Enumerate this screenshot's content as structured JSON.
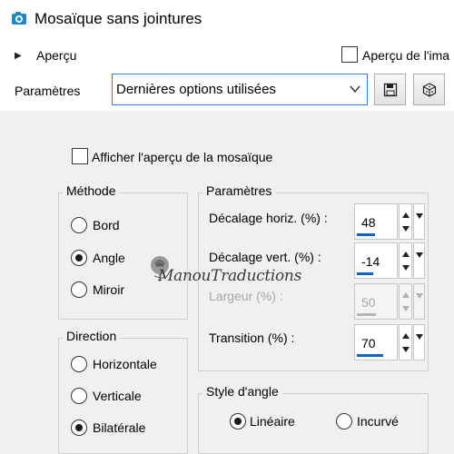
{
  "window": {
    "title": "Mosaïque sans jointures"
  },
  "preview": {
    "expander_label": "Aperçu",
    "image_preview_label": "Aperçu de l'ima"
  },
  "presets": {
    "label": "Paramètres",
    "selected": "Dernières options utilisées",
    "save_icon": "floppy-disk-icon",
    "random_icon": "dice-icon"
  },
  "show_tile_preview": {
    "label": "Afficher l'aperçu de la mosaïque",
    "checked": false
  },
  "method": {
    "title": "Méthode",
    "options": [
      {
        "label": "Bord",
        "selected": false
      },
      {
        "label": "Angle",
        "selected": true
      },
      {
        "label": "Miroir",
        "selected": false
      }
    ]
  },
  "direction": {
    "title": "Direction",
    "options": [
      {
        "label": "Horizontale",
        "selected": false
      },
      {
        "label": "Verticale",
        "selected": false
      },
      {
        "label": "Bilatérale",
        "selected": true
      }
    ]
  },
  "parameters": {
    "title": "Paramètres",
    "fields": [
      {
        "label": "Décalage horiz. (%) :",
        "value": "48",
        "enabled": true,
        "level": 0.48
      },
      {
        "label": "Décalage vert. (%) :",
        "value": "-14",
        "enabled": true,
        "level": 0.43
      },
      {
        "label": "Largeur (%) :",
        "value": "50",
        "enabled": false,
        "level": 0.5
      },
      {
        "label": "Transition (%) :",
        "value": "70",
        "enabled": true,
        "level": 0.7
      }
    ]
  },
  "corner_style": {
    "title": "Style d'angle",
    "options": [
      {
        "label": "Linéaire",
        "selected": true
      },
      {
        "label": "Incurvé",
        "selected": false
      }
    ]
  },
  "watermark": {
    "text": "ManouTraductions"
  },
  "colors": {
    "accent": "#0a66c2",
    "focus_border": "#2f7bd8",
    "icon_blue": "#1e88c8"
  }
}
